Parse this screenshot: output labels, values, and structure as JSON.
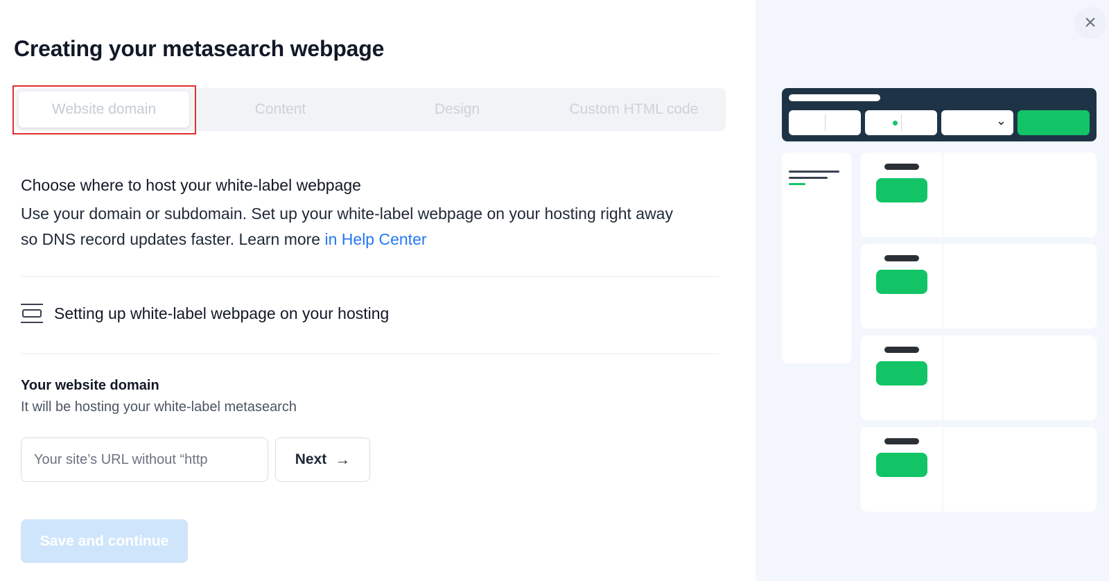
{
  "page": {
    "title": "Creating your metasearch webpage"
  },
  "tabs": [
    {
      "label": "Website domain",
      "active": true
    },
    {
      "label": "Content",
      "active": false
    },
    {
      "label": "Design",
      "active": false
    },
    {
      "label": "Custom HTML code",
      "active": false
    }
  ],
  "domain_section": {
    "heading": "Choose where to host your white-label webpage",
    "description": "Use your domain or subdomain. Set up your white-label webpage on your hosting right away so DNS record updates faster. Learn more ",
    "link_text": "in Help Center"
  },
  "hosting_item": {
    "icon": "hosting-icon",
    "label": "Setting up white-label webpage on your hosting"
  },
  "domain_field": {
    "label": "Your website domain",
    "sublabel": "It will be hosting your white-label metasearch",
    "placeholder": "Your site’s URL without “http",
    "value": "",
    "next_label": "Next",
    "next_icon": "arrow-right-icon"
  },
  "actions": {
    "save_label": "Save and continue"
  },
  "close": {
    "icon": "close-icon",
    "glyph": "×"
  },
  "colors": {
    "accent_link": "#2478f2",
    "preview_header": "#1e3446",
    "preview_green": "#12c466",
    "save_disabled": "#cfe5fb",
    "highlight": "#e0302c",
    "preview_bg": "#f3f7fd"
  }
}
